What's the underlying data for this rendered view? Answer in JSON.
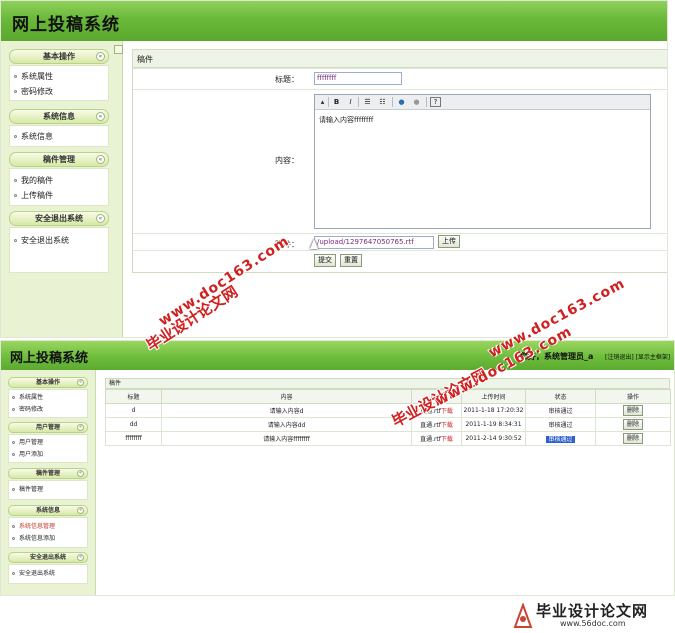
{
  "screen1": {
    "app_title": "网上投稿系统",
    "sidebar": [
      {
        "header": "基本操作",
        "items": [
          "系统属性",
          "密码修改"
        ]
      },
      {
        "header": "系统信息",
        "items": [
          "系统信息"
        ]
      },
      {
        "header": "稿件管理",
        "items": [
          "我的稿件",
          "上传稿件"
        ]
      },
      {
        "header": "安全退出系统",
        "items": [
          "安全退出系统"
        ]
      }
    ],
    "panel_title": "稿件",
    "form": {
      "title_label": "标题：",
      "title_value": "ffffffff",
      "content_label": "内容：",
      "content_value": "请输入内容ffffffff",
      "attach_label": "附件：",
      "attach_value": "/upload/1297647050765.rtf",
      "upload_button": "上传",
      "submit_button": "提交",
      "reset_button": "重置"
    },
    "toolbar": {
      "bold": "B",
      "italic": "I",
      "help": "?"
    }
  },
  "screen2": {
    "app_title": "网上投稿系统",
    "welcome": "您好，系统管理员_a",
    "header_links": "[注销退出] [显示主框架]",
    "sidebar": [
      {
        "header": "基本操作",
        "items": [
          "系统属性",
          "密码修改"
        ]
      },
      {
        "header": "用户管理",
        "items": [
          "用户管理",
          "用户添加"
        ]
      },
      {
        "header": "稿件管理",
        "items": [
          "稿件管理"
        ]
      },
      {
        "header": "系统信息",
        "items": [
          "系统信息管理",
          "系统信息添加"
        ]
      },
      {
        "header": "安全退出系统",
        "items": [
          "安全退出系统"
        ]
      }
    ],
    "table_title": "稿件",
    "columns": [
      "标题",
      "内容",
      "附件",
      "上传时间",
      "状态",
      "操作"
    ],
    "rows": [
      {
        "title": "d",
        "content": "请输入内容d",
        "attach_name": "直通.rtf",
        "attach_link": "下载",
        "time": "2011-1-18 17:20:32",
        "status": "审核通过",
        "action": "删除"
      },
      {
        "title": "dd",
        "content": "请输入内容dd",
        "attach_name": "直通.rtf",
        "attach_link": "下载",
        "time": "2011-1-19 8:34:31",
        "status": "审核通过",
        "action": "删除"
      },
      {
        "title": "ffffffff",
        "content": "请输入内容ffffffff",
        "attach_name": "直通.rtf",
        "attach_link": "下载",
        "time": "2011-2-14 9:30:52",
        "status": "审核通过",
        "action": "删除"
      }
    ]
  },
  "watermarks": {
    "site_cn": "毕业设计论文网",
    "site_url": "www.doc163.com"
  },
  "footer_logo": {
    "cn": "毕业设计论文网",
    "url": "www.56doc.com"
  },
  "colors": {
    "header_green": "#6ab93a",
    "sidebar_bg": "#e9f3d4",
    "watermark_red": "#d02020",
    "selected_blue": "#2f5fd0"
  }
}
